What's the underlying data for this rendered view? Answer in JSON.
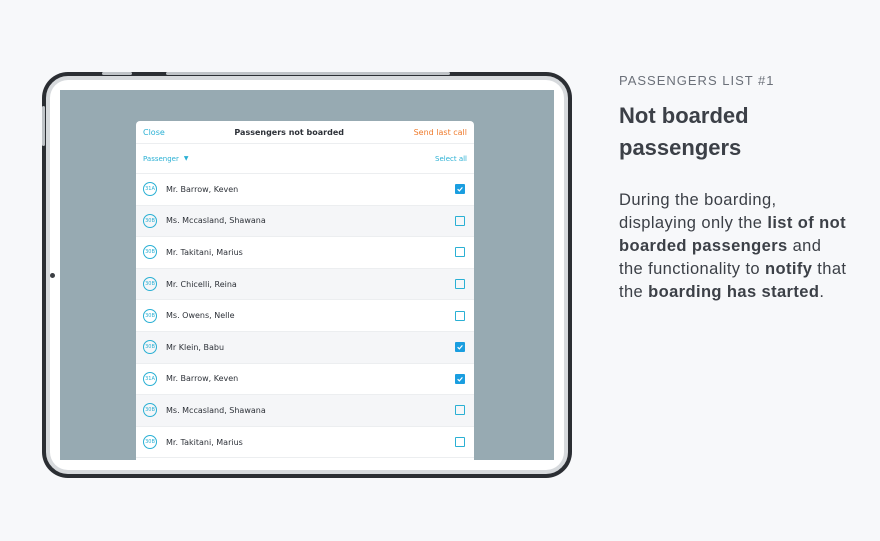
{
  "side": {
    "eyebrow": "PASSENGERS LIST #1",
    "heading_line1": "Not boarded",
    "heading_line2": "passengers",
    "desc": [
      {
        "text": "During the boarding, displaying only the ",
        "bold": false
      },
      {
        "text": "list of not boarded passengers",
        "bold": true
      },
      {
        "text": " and the functionality to ",
        "bold": false
      },
      {
        "text": "notify",
        "bold": true
      },
      {
        "text": " that the ",
        "bold": false
      },
      {
        "text": "boarding has started",
        "bold": true
      },
      {
        "text": ".",
        "bold": false
      }
    ]
  },
  "modal": {
    "close_label": "Close",
    "title": "Passengers not boarded",
    "send_label": "Send last call",
    "filter_label": "Passenger",
    "select_all_label": "Select all",
    "passengers": [
      {
        "seat": "31A",
        "name": "Mr. Barrow, Keven",
        "checked": true
      },
      {
        "seat": "30B",
        "name": "Ms. Mccasland, Shawana",
        "checked": false
      },
      {
        "seat": "30B",
        "name": "Mr. Takitani, Marius",
        "checked": false
      },
      {
        "seat": "30B",
        "name": "Mr. Chicelli, Reina",
        "checked": false
      },
      {
        "seat": "30B",
        "name": "Ms. Owens, Nelle",
        "checked": false
      },
      {
        "seat": "30B",
        "name": "Mr Klein, Babu",
        "checked": true
      },
      {
        "seat": "31A",
        "name": "Mr. Barrow, Keven",
        "checked": true
      },
      {
        "seat": "30B",
        "name": "Ms. Mccasland, Shawana",
        "checked": false
      },
      {
        "seat": "30B",
        "name": "Mr. Takitani, Marius",
        "checked": false
      }
    ]
  },
  "colors": {
    "accent": "#2ab0d4",
    "send": "#ef7c2e",
    "checked": "#1a9ee0",
    "screen_bg": "#97aab2"
  }
}
